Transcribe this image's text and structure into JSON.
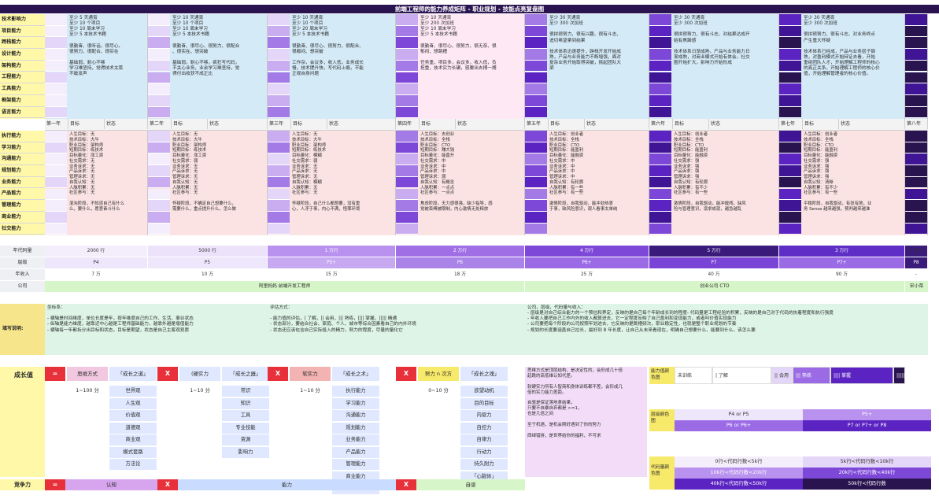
{
  "title": "前端工程师的能力养成矩阵 - 职业规划 - 技能点亮复盘图",
  "skills": [
    "技术影响力",
    "项目能力",
    "跨栈能力",
    "设计能力",
    "架构能力",
    "工程能力",
    "工具能力",
    "框架能力",
    "语言能力"
  ],
  "soft": [
    "执行能力",
    "学习能力",
    "沟通能力",
    "规划能力",
    "业务能力",
    "产品能力",
    "管理能力",
    "商业能力",
    "社交能力"
  ],
  "tech_cells": [
    "至少 5 天通宵\n至少 10 个项目\n至少 10 周末学习\n至少 5 本技术书籍\n\n很勤奋、很听话、很尽心、\n很努力、很配合、很实在\n\n基础弱，耐心不够\n学习难坚持，觉得技术太菜\n不敢发声",
    "至少 10 天通宵\n至少 10 个项目\n至少 10 周末学习\n至少 5 本技术书籍\n\n很勤奋、很尽心、很努力、很配合\n、很实在、想突破\n\n基础弱，耐心不够，疯狂写代码，\n不关心业务，业余学习难坚持，觉\n得付出收获不成正比",
    "至少 10 天通宵\n至少 10 个项目\n至少 20 周末学习\n至少 5 本技术书籍\n\n很勤奋、很尽心、很努力、很配合、\n很都闷、想突破\n\n工作杂，会议多，收入低，业务成长\n慢，技术提升快，写代码上瘾，不能\n正视自身问题",
    "至少 10 天通宵\n至少 200 次加班\n至少 10 周末学习\n至少 5 本技术书籍\n\n很勤奋、很尽心、很努力、很无奈、很\n郁闷、想跳槽\n\n任务重，项目多，会议多，收入低，负\n担重，技术实力长碾，感要出去搏一搏",
    "至少 30 天通宵\n至少 300 次加班\n\n很拼很努力、很有兴趣、很有斗志、\n追切希望拿到结果\n\n技术体系迅速提升，跨栈开发开始成\n熟，产品与业务能力不断增强，面对\n复杂业务开始取得突破，挑起团队大\n梁",
    "至少 30 天通宵\n至少 300 次加班\n\n很拼很努力、很有斗志、对结果达成开\n始有焦躁感\n\n技术体系日渐成熟，产品与业务能力日\n渐成熟，对商业模式开始有体会，社交\n圈开始扩大，影响力开始形成",
    "至少 30 天通宵\n至少 300 次加班\n\n很拼很努力、很有斗志、对业务终点\n产生重大怀疑\n\n技术体系已经成，产品与业务层子钢\n熟，对盈利模式开始辩证去看，开始\n重组团队人才，开始理解工程师的核心\n的真正关系，开始理解工程师的核心价\n值，开始理解管理者的核心价值。"
  ],
  "year_labels": [
    "第一年",
    "第二年",
    "第三年",
    "第四年",
    "第五年",
    "第六年",
    "第七年",
    "第八年"
  ],
  "goal_label": "目标",
  "status_label": "状态",
  "person_cells": [
    "人生目标：无\n技术目标：大牛\n职业目标：架构师\n短期目标：练技术\n目标量化：涨工资\n社交需求：无\n业务诉求：无\n产品诉求：无\n管理诉求：无\n自我认知：无\n人脉积累：无\n社区参与：无\n\n混沌阶段，不知道自己有什么\n么，要什么，愿意奋斗什么",
    "人生目标：无\n技术目标：大牛\n职业目标：架构师\n短期目标：练技术\n目标量化：涨工资\n社交需求：弱\n业务诉求：无\n产品诉求：无\n管理诉求：无\n自我认知：无\n人脉积累：无\n社区参与：无\n\n怀疑阶段，不确定自己想要什么，\n需要什么，重点提升什么，怎么做",
    "人生目标：无\n技术目标：大牛\n职业目标：架构师\n短期目标：练技术\n目标量化：模糊\n社交需求：弱\n业务诉求：无\n产品诉求：无\n管理诉求：无\n自我认知：模糊\n人脉积累：无\n社区参与：无\n\n怀疑阶段，自己什么都想要，没有重\n心，人浮于事，内心不满，怪罪环境",
    "人生目标：去创业\n技术目标：全栈\n职业目标：CTO\n短期目标：赚大钱\n目标量化：能晋升\n社交需求：中\n业务诉求：中\n产品诉求：中\n管理诉求：弱\n自我认知：有概念\n人脉积累：一点点\n社区参与：一点点\n\n焦虑阶段，无力感很强，缺少指导，感\n觉被束缚被限制，内心激情无处释放",
    "人生目标：创业者\n技术目标：全栈\n职业目标：CTO\n短期目标：能盈利\n目标量化：能融资\n社交需求：中\n业务诉求：中\n产品诉求：中\n管理诉求：中\n自我认知：有轮廓\n人脉积累：有一些\n社区参与：有一些\n\n激情阶段，自我驱动，能冲劲热衷\n于事，缺风险意识，观人看事太单纯",
    "人生目标：创业者\n技术目标：全栈\n职业目标：CTO\n短期目标：能盈利\n目标量化：能融资\n社交需求：强\n业务诉求：强\n产品诉求：强\n管理诉求：强\n自我认知：有轮廓\n人脉积累：有不少\n社区参与：有一些\n\n激情阶段，自我驱动，能冲敢闯，缺风\n险与管理意识，凛求成就，越急越乱",
    "人生目标：创业者\n技术目标：全栈\n职业目标：CTO\n短期目标：能盈利\n目标量化：能融资\n社交需求：强\n业务诉求：强\n产品诉求：强\n管理诉求：强\n自我认知：清晰\n人脉积累：有不少\n社区参与：有一些\n\n平稳阶段，自我驱动，有张有弛，业\n务 Sense 越来越强，预判越来越准"
  ],
  "summary_rows": [
    {
      "label": "年代码量",
      "values": [
        "2000 行",
        "5000 行",
        "1 万行",
        "2 万行",
        "4 万行",
        "5 万行",
        "3 万行",
        "1 万行"
      ]
    },
    {
      "label": "层级",
      "values": [
        "P4",
        "P5",
        "P5+",
        "P6",
        "P6+",
        "P7",
        "P7+",
        "P8"
      ]
    },
    {
      "label": "年收入",
      "values": [
        "7 万",
        "10 万",
        "15 万",
        "18 万",
        "25 万",
        "40 万",
        "90 万",
        "-"
      ]
    }
  ],
  "company_label": "公司",
  "companies": [
    "阿里妈妈 前端开发工程师",
    "创业公司 CTO",
    "宋小菜"
  ],
  "fill_label": "填写说明:",
  "notes": [
    "坐标系：\n\n- 横轴是时间维度，单位长度是年，按年维度自己的工作、生活、事业状态\n- 纵轴是能力维度，越靠近中心越是工程师基础能力，越靠外越是增值能力\n- 横轴每一年都拆分出目标和状态，目标是期望，状态是自己主客观意愿",
    "评估方式：\n\n- 能力值的评估，| 了解，|| 会用，||| 熟练，|||| 掌握，||||| 精通\n- 状态部分，要结合社会、家庭、个人、城市等综合因素看自己的内外环境\n- 状态还应该包含自己实际投入的精力，努力的程度，尽量的量化它",
    "公司、层级、代码量与收入：\n- 层级是对自己综合能力的一个预估和界定，反映的是自己每个年龄成长到的程度- 代码量是工程经验的积累，反映的是自己对于代码的执着程度和执行强度\n- 年收入要把自己工作内外的收入都算进去，它一定程度反映了自己盈利和变现能力，或者叫价值实现能力\n- 公司要把每个阶段的公司按照年划进去，它反映的是跳槽频次，职业稳定性，也就是整个职业规划的节奏\n- 规划的长度要涵盖自己拉长，最好到 8 年长度，让自己从未来看现在，明确自己想要什么、能要到什么，该怎么要"
  ],
  "growth_label": "成长值",
  "compete_label": "竞争力",
  "ops": {
    "eq": "=",
    "x": "X"
  },
  "formula": [
    {
      "head": "思维方式",
      "sub": "「成长之道」",
      "range": "1~100 分",
      "items": [
        "世界观",
        "人生观",
        "价值观",
        "道德观",
        "商业观",
        "模式套路",
        "方法论"
      ]
    },
    {
      "head": "(硬实力",
      "sub": "「成长之器」",
      "range": "1~10 分",
      "items": [
        "常识",
        "知识",
        "工具",
        "专业技能",
        "资源",
        "影响力"
      ]
    },
    {
      "head": "软实力",
      "sub": "「成长之术」",
      "range": "1~10 分",
      "items": [
        "执行能力",
        "学习能力",
        "沟通能力",
        "规划能力",
        "业务能力",
        "产品能力",
        "管理能力",
        "商业能力",
        "社交能力"
      ]
    },
    {
      "head": "努力 n 次方",
      "sub": "「成长之魂」",
      "range": "0~10 分",
      "items": [
        "欲望动机",
        "目的目标",
        "内驱力",
        "自控力",
        "自律力",
        "行动力",
        "持久耐力",
        "「心脑体」"
      ]
    }
  ],
  "bottom_labels": [
    "认知",
    "能力",
    "自驱"
  ],
  "philosophy": "思维方式是顶层结构，是决定性的，会形成几十倍\n起跳的高低维认知代差。\n\n软硬实力所有人智商和身体训练都不差，会形成几\n倍的实力能力差距。\n\n自驱是保证落地拿结果，\n只要不自暴自弃都是 >=1，\n也是几倍之间\n\n至于机遇，是机会刚好遇到了你的努力\n\n西绰错拼，是世界给你的福利，不可求",
  "legend_ability": {
    "title": "能力值颜色图",
    "items": [
      "未训练",
      "| 了解",
      "|| 会用",
      "||| 熟练",
      "|||| 掌握",
      "||||| 精通"
    ]
  },
  "legend_level": {
    "title": "层级颜色图",
    "items": [
      "P4 or P5",
      "P5+",
      "P6 or P6+",
      "P7 or P7+ or P8"
    ]
  },
  "legend_code": {
    "title": "代码量颜色图",
    "items": [
      "0行<代码行数<5k行",
      "5k行<代码行数<10k行",
      "10k行<代码行数<20k行",
      "20k行<代码行数<40k行",
      "40k行<代码行数<50k行",
      "50k行<代码行数"
    ]
  },
  "colors": {
    "dark": "#2a1450",
    "purple": "#6a2fd0",
    "mid": "#9b6be6",
    "light": "#d9c8f5",
    "blue": "#d4eaf7",
    "pink": "#fbe3e3",
    "green": "#d6f5c8",
    "yellow": "#f7e96a",
    "red": "#e8303a"
  }
}
